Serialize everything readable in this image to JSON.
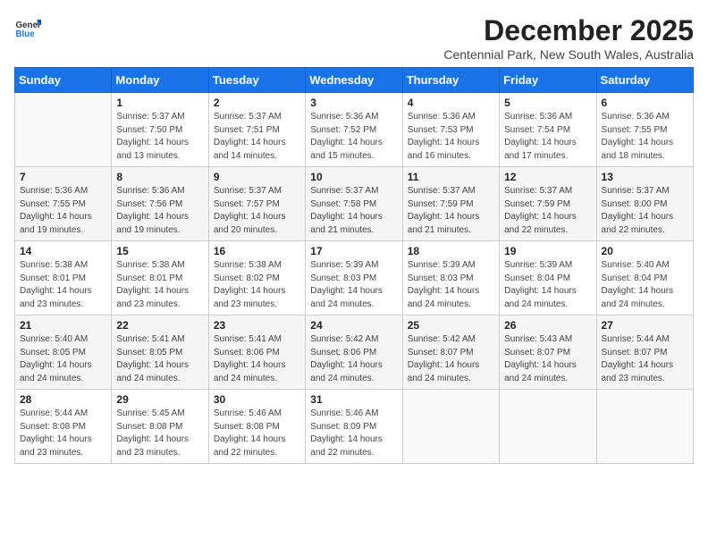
{
  "header": {
    "logo_line1": "General",
    "logo_line2": "Blue",
    "title": "December 2025",
    "subtitle": "Centennial Park, New South Wales, Australia"
  },
  "days_of_week": [
    "Sunday",
    "Monday",
    "Tuesday",
    "Wednesday",
    "Thursday",
    "Friday",
    "Saturday"
  ],
  "weeks": [
    [
      {
        "day": "",
        "info": ""
      },
      {
        "day": "1",
        "info": "Sunrise: 5:37 AM\nSunset: 7:50 PM\nDaylight: 14 hours\nand 13 minutes."
      },
      {
        "day": "2",
        "info": "Sunrise: 5:37 AM\nSunset: 7:51 PM\nDaylight: 14 hours\nand 14 minutes."
      },
      {
        "day": "3",
        "info": "Sunrise: 5:36 AM\nSunset: 7:52 PM\nDaylight: 14 hours\nand 15 minutes."
      },
      {
        "day": "4",
        "info": "Sunrise: 5:36 AM\nSunset: 7:53 PM\nDaylight: 14 hours\nand 16 minutes."
      },
      {
        "day": "5",
        "info": "Sunrise: 5:36 AM\nSunset: 7:54 PM\nDaylight: 14 hours\nand 17 minutes."
      },
      {
        "day": "6",
        "info": "Sunrise: 5:36 AM\nSunset: 7:55 PM\nDaylight: 14 hours\nand 18 minutes."
      }
    ],
    [
      {
        "day": "7",
        "info": "Sunrise: 5:36 AM\nSunset: 7:55 PM\nDaylight: 14 hours\nand 19 minutes."
      },
      {
        "day": "8",
        "info": "Sunrise: 5:36 AM\nSunset: 7:56 PM\nDaylight: 14 hours\nand 19 minutes."
      },
      {
        "day": "9",
        "info": "Sunrise: 5:37 AM\nSunset: 7:57 PM\nDaylight: 14 hours\nand 20 minutes."
      },
      {
        "day": "10",
        "info": "Sunrise: 5:37 AM\nSunset: 7:58 PM\nDaylight: 14 hours\nand 21 minutes."
      },
      {
        "day": "11",
        "info": "Sunrise: 5:37 AM\nSunset: 7:59 PM\nDaylight: 14 hours\nand 21 minutes."
      },
      {
        "day": "12",
        "info": "Sunrise: 5:37 AM\nSunset: 7:59 PM\nDaylight: 14 hours\nand 22 minutes."
      },
      {
        "day": "13",
        "info": "Sunrise: 5:37 AM\nSunset: 8:00 PM\nDaylight: 14 hours\nand 22 minutes."
      }
    ],
    [
      {
        "day": "14",
        "info": "Sunrise: 5:38 AM\nSunset: 8:01 PM\nDaylight: 14 hours\nand 23 minutes."
      },
      {
        "day": "15",
        "info": "Sunrise: 5:38 AM\nSunset: 8:01 PM\nDaylight: 14 hours\nand 23 minutes."
      },
      {
        "day": "16",
        "info": "Sunrise: 5:38 AM\nSunset: 8:02 PM\nDaylight: 14 hours\nand 23 minutes."
      },
      {
        "day": "17",
        "info": "Sunrise: 5:39 AM\nSunset: 8:03 PM\nDaylight: 14 hours\nand 24 minutes."
      },
      {
        "day": "18",
        "info": "Sunrise: 5:39 AM\nSunset: 8:03 PM\nDaylight: 14 hours\nand 24 minutes."
      },
      {
        "day": "19",
        "info": "Sunrise: 5:39 AM\nSunset: 8:04 PM\nDaylight: 14 hours\nand 24 minutes."
      },
      {
        "day": "20",
        "info": "Sunrise: 5:40 AM\nSunset: 8:04 PM\nDaylight: 14 hours\nand 24 minutes."
      }
    ],
    [
      {
        "day": "21",
        "info": "Sunrise: 5:40 AM\nSunset: 8:05 PM\nDaylight: 14 hours\nand 24 minutes."
      },
      {
        "day": "22",
        "info": "Sunrise: 5:41 AM\nSunset: 8:05 PM\nDaylight: 14 hours\nand 24 minutes."
      },
      {
        "day": "23",
        "info": "Sunrise: 5:41 AM\nSunset: 8:06 PM\nDaylight: 14 hours\nand 24 minutes."
      },
      {
        "day": "24",
        "info": "Sunrise: 5:42 AM\nSunset: 8:06 PM\nDaylight: 14 hours\nand 24 minutes."
      },
      {
        "day": "25",
        "info": "Sunrise: 5:42 AM\nSunset: 8:07 PM\nDaylight: 14 hours\nand 24 minutes."
      },
      {
        "day": "26",
        "info": "Sunrise: 5:43 AM\nSunset: 8:07 PM\nDaylight: 14 hours\nand 24 minutes."
      },
      {
        "day": "27",
        "info": "Sunrise: 5:44 AM\nSunset: 8:07 PM\nDaylight: 14 hours\nand 23 minutes."
      }
    ],
    [
      {
        "day": "28",
        "info": "Sunrise: 5:44 AM\nSunset: 8:08 PM\nDaylight: 14 hours\nand 23 minutes."
      },
      {
        "day": "29",
        "info": "Sunrise: 5:45 AM\nSunset: 8:08 PM\nDaylight: 14 hours\nand 23 minutes."
      },
      {
        "day": "30",
        "info": "Sunrise: 5:46 AM\nSunset: 8:08 PM\nDaylight: 14 hours\nand 22 minutes."
      },
      {
        "day": "31",
        "info": "Sunrise: 5:46 AM\nSunset: 8:09 PM\nDaylight: 14 hours\nand 22 minutes."
      },
      {
        "day": "",
        "info": ""
      },
      {
        "day": "",
        "info": ""
      },
      {
        "day": "",
        "info": ""
      }
    ]
  ]
}
